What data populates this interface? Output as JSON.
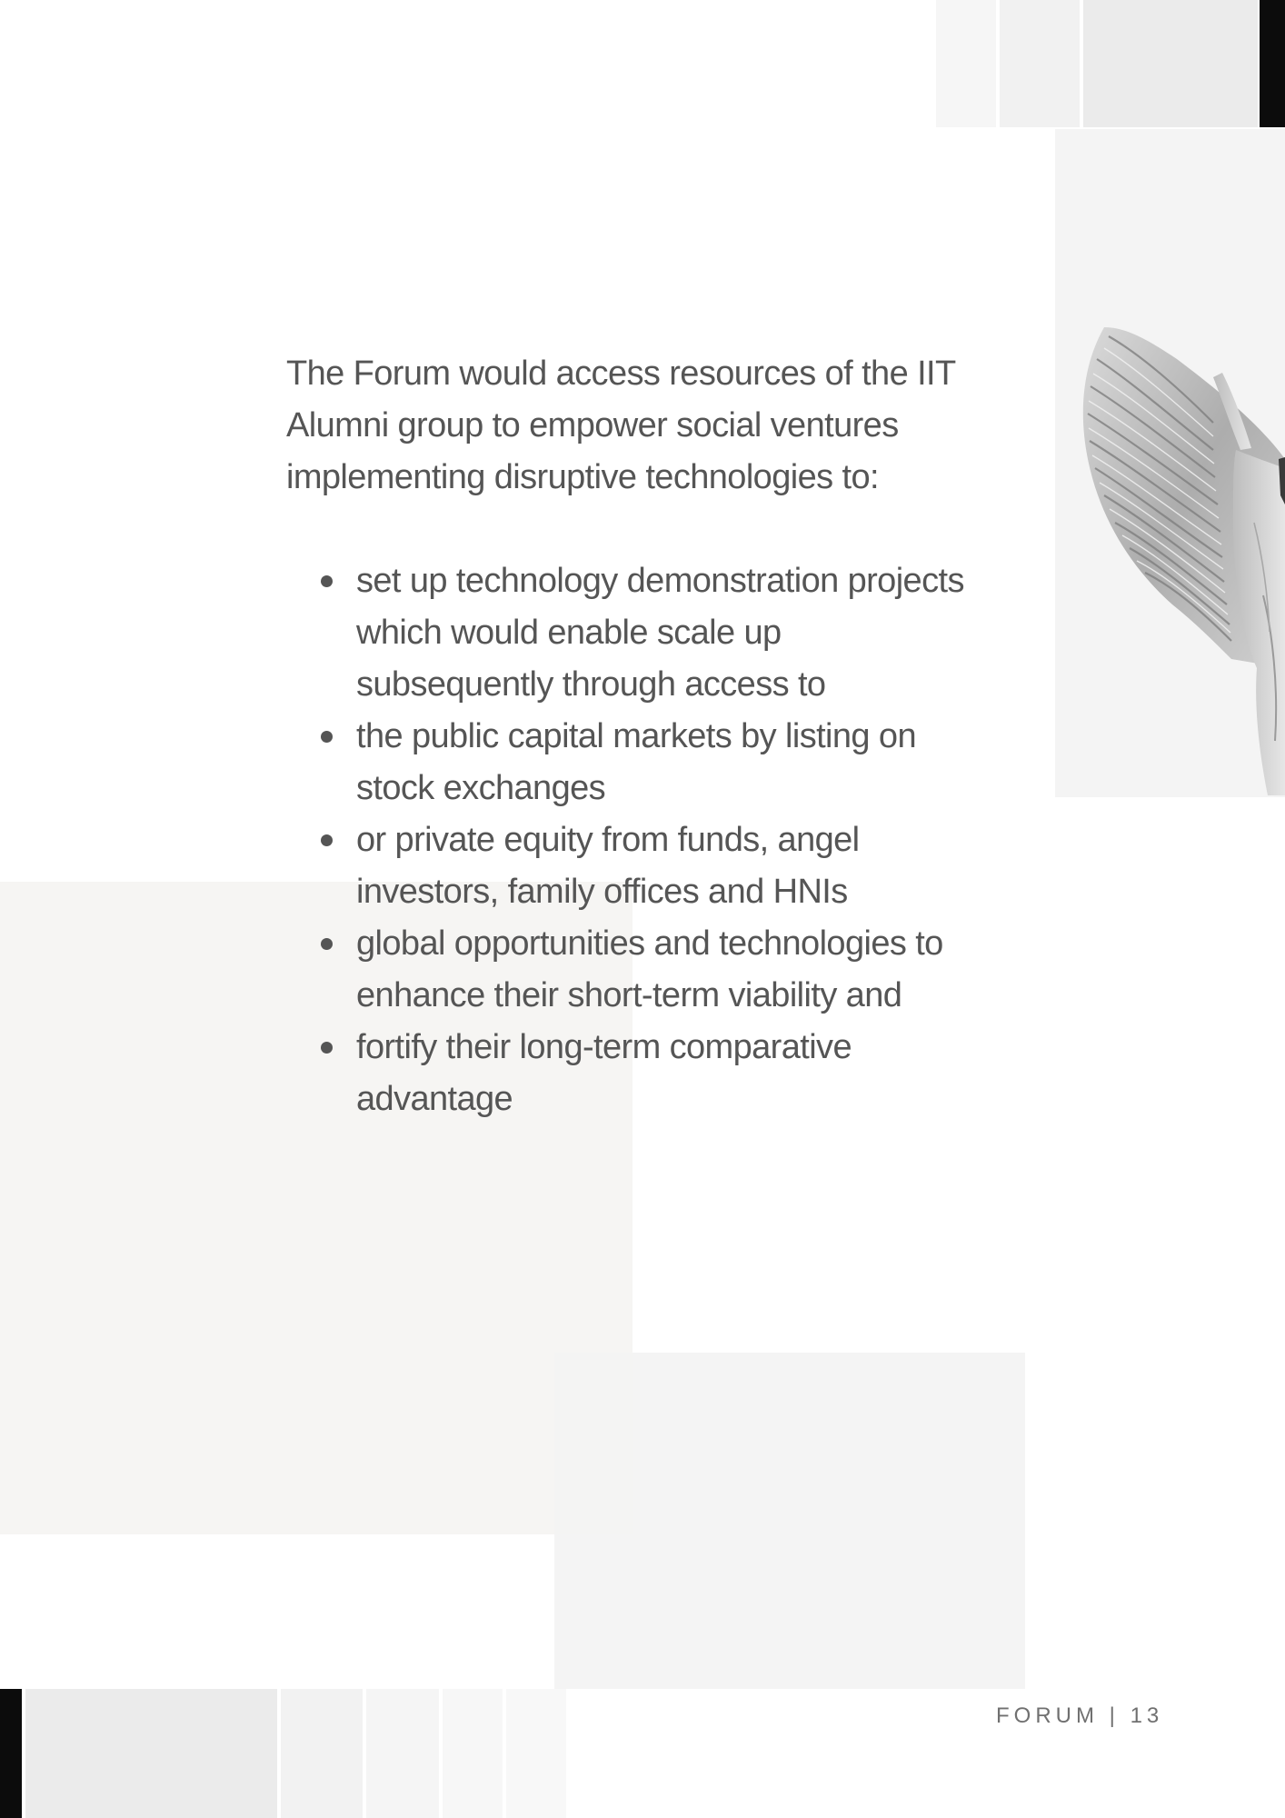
{
  "content": {
    "intro": "The Forum would access resources of the IIT Alumni group to empower social ventures implementing disruptive technologies to:",
    "bullets": [
      "set up technology demonstration projects which would enable scale up subsequently through access to",
      "the public capital markets by listing on stock exchanges",
      "or private equity from funds, angel investors, family offices and HNIs",
      "global opportunities and technologies to enhance their short-term viability and",
      "fortify their long-term comparative advantage"
    ]
  },
  "footer": {
    "label": "FORUM",
    "separator": "|",
    "page_number": "13"
  },
  "illustration": {
    "icon": "winged-statue-icon"
  }
}
